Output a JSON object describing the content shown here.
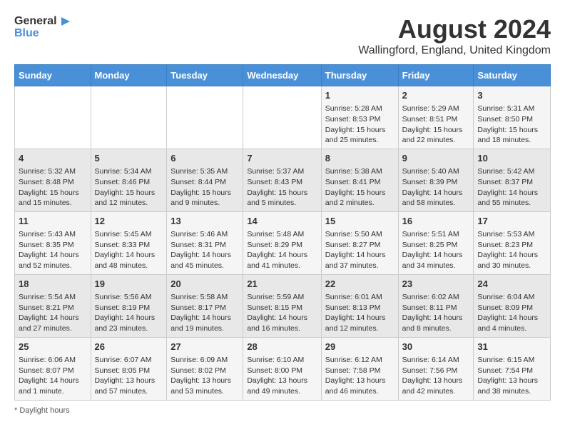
{
  "logo": {
    "line1": "General",
    "line2": "Blue"
  },
  "title": "August 2024",
  "subtitle": "Wallingford, England, United Kingdom",
  "days_of_week": [
    "Sunday",
    "Monday",
    "Tuesday",
    "Wednesday",
    "Thursday",
    "Friday",
    "Saturday"
  ],
  "footer": "Daylight hours",
  "weeks": [
    [
      {
        "day": "",
        "info": ""
      },
      {
        "day": "",
        "info": ""
      },
      {
        "day": "",
        "info": ""
      },
      {
        "day": "",
        "info": ""
      },
      {
        "day": "1",
        "info": "Sunrise: 5:28 AM\nSunset: 8:53 PM\nDaylight: 15 hours and 25 minutes."
      },
      {
        "day": "2",
        "info": "Sunrise: 5:29 AM\nSunset: 8:51 PM\nDaylight: 15 hours and 22 minutes."
      },
      {
        "day": "3",
        "info": "Sunrise: 5:31 AM\nSunset: 8:50 PM\nDaylight: 15 hours and 18 minutes."
      }
    ],
    [
      {
        "day": "4",
        "info": "Sunrise: 5:32 AM\nSunset: 8:48 PM\nDaylight: 15 hours and 15 minutes."
      },
      {
        "day": "5",
        "info": "Sunrise: 5:34 AM\nSunset: 8:46 PM\nDaylight: 15 hours and 12 minutes."
      },
      {
        "day": "6",
        "info": "Sunrise: 5:35 AM\nSunset: 8:44 PM\nDaylight: 15 hours and 9 minutes."
      },
      {
        "day": "7",
        "info": "Sunrise: 5:37 AM\nSunset: 8:43 PM\nDaylight: 15 hours and 5 minutes."
      },
      {
        "day": "8",
        "info": "Sunrise: 5:38 AM\nSunset: 8:41 PM\nDaylight: 15 hours and 2 minutes."
      },
      {
        "day": "9",
        "info": "Sunrise: 5:40 AM\nSunset: 8:39 PM\nDaylight: 14 hours and 58 minutes."
      },
      {
        "day": "10",
        "info": "Sunrise: 5:42 AM\nSunset: 8:37 PM\nDaylight: 14 hours and 55 minutes."
      }
    ],
    [
      {
        "day": "11",
        "info": "Sunrise: 5:43 AM\nSunset: 8:35 PM\nDaylight: 14 hours and 52 minutes."
      },
      {
        "day": "12",
        "info": "Sunrise: 5:45 AM\nSunset: 8:33 PM\nDaylight: 14 hours and 48 minutes."
      },
      {
        "day": "13",
        "info": "Sunrise: 5:46 AM\nSunset: 8:31 PM\nDaylight: 14 hours and 45 minutes."
      },
      {
        "day": "14",
        "info": "Sunrise: 5:48 AM\nSunset: 8:29 PM\nDaylight: 14 hours and 41 minutes."
      },
      {
        "day": "15",
        "info": "Sunrise: 5:50 AM\nSunset: 8:27 PM\nDaylight: 14 hours and 37 minutes."
      },
      {
        "day": "16",
        "info": "Sunrise: 5:51 AM\nSunset: 8:25 PM\nDaylight: 14 hours and 34 minutes."
      },
      {
        "day": "17",
        "info": "Sunrise: 5:53 AM\nSunset: 8:23 PM\nDaylight: 14 hours and 30 minutes."
      }
    ],
    [
      {
        "day": "18",
        "info": "Sunrise: 5:54 AM\nSunset: 8:21 PM\nDaylight: 14 hours and 27 minutes."
      },
      {
        "day": "19",
        "info": "Sunrise: 5:56 AM\nSunset: 8:19 PM\nDaylight: 14 hours and 23 minutes."
      },
      {
        "day": "20",
        "info": "Sunrise: 5:58 AM\nSunset: 8:17 PM\nDaylight: 14 hours and 19 minutes."
      },
      {
        "day": "21",
        "info": "Sunrise: 5:59 AM\nSunset: 8:15 PM\nDaylight: 14 hours and 16 minutes."
      },
      {
        "day": "22",
        "info": "Sunrise: 6:01 AM\nSunset: 8:13 PM\nDaylight: 14 hours and 12 minutes."
      },
      {
        "day": "23",
        "info": "Sunrise: 6:02 AM\nSunset: 8:11 PM\nDaylight: 14 hours and 8 minutes."
      },
      {
        "day": "24",
        "info": "Sunrise: 6:04 AM\nSunset: 8:09 PM\nDaylight: 14 hours and 4 minutes."
      }
    ],
    [
      {
        "day": "25",
        "info": "Sunrise: 6:06 AM\nSunset: 8:07 PM\nDaylight: 14 hours and 1 minute."
      },
      {
        "day": "26",
        "info": "Sunrise: 6:07 AM\nSunset: 8:05 PM\nDaylight: 13 hours and 57 minutes."
      },
      {
        "day": "27",
        "info": "Sunrise: 6:09 AM\nSunset: 8:02 PM\nDaylight: 13 hours and 53 minutes."
      },
      {
        "day": "28",
        "info": "Sunrise: 6:10 AM\nSunset: 8:00 PM\nDaylight: 13 hours and 49 minutes."
      },
      {
        "day": "29",
        "info": "Sunrise: 6:12 AM\nSunset: 7:58 PM\nDaylight: 13 hours and 46 minutes."
      },
      {
        "day": "30",
        "info": "Sunrise: 6:14 AM\nSunset: 7:56 PM\nDaylight: 13 hours and 42 minutes."
      },
      {
        "day": "31",
        "info": "Sunrise: 6:15 AM\nSunset: 7:54 PM\nDaylight: 13 hours and 38 minutes."
      }
    ]
  ]
}
